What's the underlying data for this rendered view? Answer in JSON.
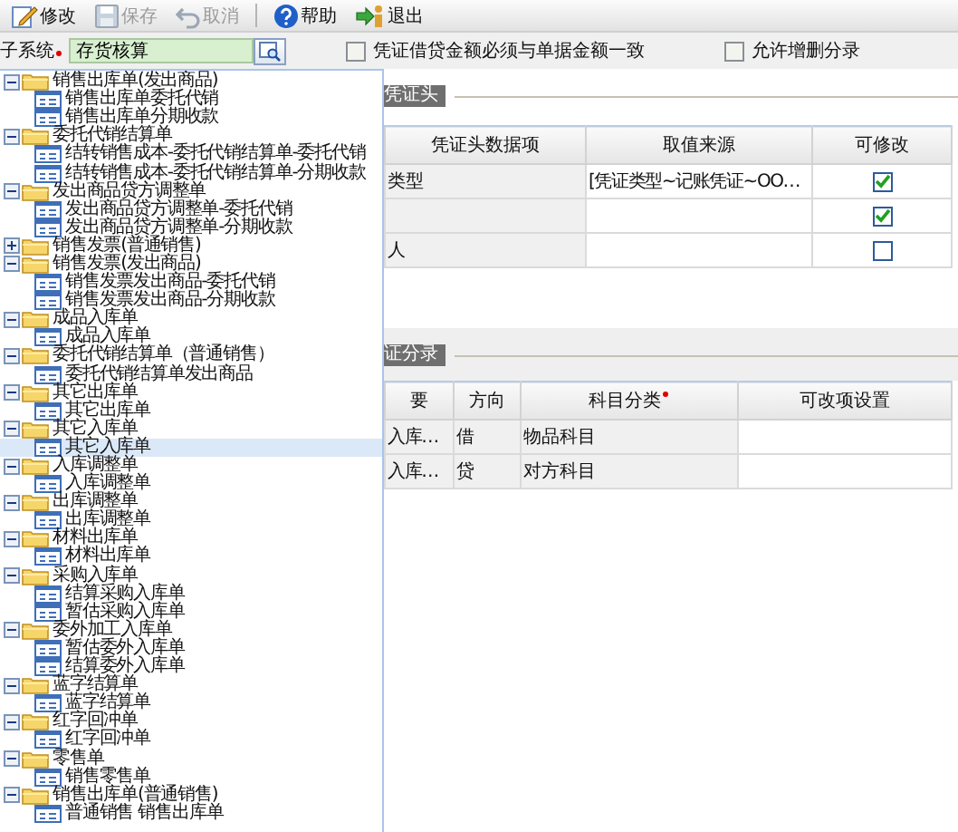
{
  "toolbar": [
    {
      "label": "修改",
      "kind": "edit",
      "disabled": false
    },
    {
      "label": "保存",
      "kind": "save",
      "disabled": true
    },
    {
      "label": "取消",
      "kind": "cancel",
      "disabled": true
    },
    {
      "label": "帮助",
      "kind": "help",
      "disabled": false
    },
    {
      "label": "退出",
      "kind": "exit",
      "disabled": false
    }
  ],
  "filter": {
    "label": "子系统",
    "required": true,
    "value": "存货核算"
  },
  "options": [
    {
      "label": "凭证借贷金额必须与单据金额一致",
      "checked": false
    },
    {
      "label": "允许增删分录",
      "checked": false
    }
  ],
  "tree": [
    {
      "label": "销售出库单(发出商品)",
      "expanded": true,
      "selected": false,
      "children": [
        {
          "label": "销售出库单委托代销",
          "selected": false
        },
        {
          "label": "销售出库单分期收款",
          "selected": false
        }
      ]
    },
    {
      "label": "委托代销结算单",
      "expanded": true,
      "selected": false,
      "children": [
        {
          "label": "结转销售成本-委托代销结算单-委托代销",
          "selected": false
        },
        {
          "label": "结转销售成本-委托代销结算单-分期收款",
          "selected": false
        }
      ]
    },
    {
      "label": "发出商品贷方调整单",
      "expanded": true,
      "selected": false,
      "children": [
        {
          "label": "发出商品贷方调整单-委托代销",
          "selected": false
        },
        {
          "label": "发出商品贷方调整单-分期收款",
          "selected": false
        }
      ]
    },
    {
      "label": "销售发票(普通销售)",
      "expanded": false,
      "selected": false
    },
    {
      "label": "销售发票(发出商品)",
      "expanded": true,
      "selected": false,
      "children": [
        {
          "label": "销售发票发出商品-委托代销",
          "selected": false
        },
        {
          "label": "销售发票发出商品-分期收款",
          "selected": false
        }
      ]
    },
    {
      "label": "成品入库单",
      "expanded": true,
      "selected": false,
      "children": [
        {
          "label": "成品入库单",
          "selected": false
        }
      ]
    },
    {
      "label": "委托代销结算单（普通销售）",
      "expanded": true,
      "selected": false,
      "children": [
        {
          "label": "委托代销结算单发出商品",
          "selected": false
        }
      ]
    },
    {
      "label": "其它出库单",
      "expanded": true,
      "selected": false,
      "children": [
        {
          "label": "其它出库单",
          "selected": false
        }
      ]
    },
    {
      "label": "其它入库单",
      "expanded": true,
      "selected": false,
      "children": [
        {
          "label": "其它入库单",
          "selected": true
        }
      ]
    },
    {
      "label": "入库调整单",
      "expanded": true,
      "selected": false,
      "children": [
        {
          "label": "入库调整单",
          "selected": false
        }
      ]
    },
    {
      "label": "出库调整单",
      "expanded": true,
      "selected": false,
      "children": [
        {
          "label": "出库调整单",
          "selected": false
        }
      ]
    },
    {
      "label": "材料出库单",
      "expanded": true,
      "selected": false,
      "children": [
        {
          "label": "材料出库单",
          "selected": false
        }
      ]
    },
    {
      "label": "采购入库单",
      "expanded": true,
      "selected": false,
      "children": [
        {
          "label": "结算采购入库单",
          "selected": false
        },
        {
          "label": "暂估采购入库单",
          "selected": false
        }
      ]
    },
    {
      "label": "委外加工入库单",
      "expanded": true,
      "selected": false,
      "children": [
        {
          "label": "暂估委外入库单",
          "selected": false
        },
        {
          "label": "结算委外入库单",
          "selected": false
        }
      ]
    },
    {
      "label": "蓝字结算单",
      "expanded": true,
      "selected": false,
      "children": [
        {
          "label": "蓝字结算单",
          "selected": false
        }
      ]
    },
    {
      "label": "红字回冲单",
      "expanded": true,
      "selected": false,
      "children": [
        {
          "label": "红字回冲单",
          "selected": false
        }
      ]
    },
    {
      "label": "零售单",
      "expanded": true,
      "selected": false,
      "children": [
        {
          "label": "销售零售单",
          "selected": false
        }
      ]
    },
    {
      "label": "销售出库单(普通销售)",
      "expanded": true,
      "selected": false,
      "children": [
        {
          "label": "普通销售 销售出库单",
          "selected": false
        }
      ]
    }
  ],
  "header_section": {
    "title": "凭证头",
    "columns": [
      {
        "label": "凭证头数据项",
        "required": false
      },
      {
        "label": "取值来源",
        "required": false
      },
      {
        "label": "可修改",
        "required": false
      }
    ],
    "rows": [
      {
        "item": "类型",
        "source": "[凭证类型~记账凭证~OO…",
        "editable": true
      },
      {
        "editable": true
      },
      {
        "item": "人",
        "editable": false
      }
    ]
  },
  "entry_section": {
    "title": "证分录",
    "columns": [
      {
        "label": "要",
        "required": false
      },
      {
        "label": "方向",
        "required": false
      },
      {
        "label": "科目分类",
        "required": true
      },
      {
        "label": "可改项设置",
        "required": false
      }
    ],
    "rows": [
      {
        "summary": "入库…",
        "direction": "借",
        "category": "物品科目"
      },
      {
        "summary": "入库…",
        "direction": "贷",
        "category": "对方科目"
      }
    ]
  }
}
